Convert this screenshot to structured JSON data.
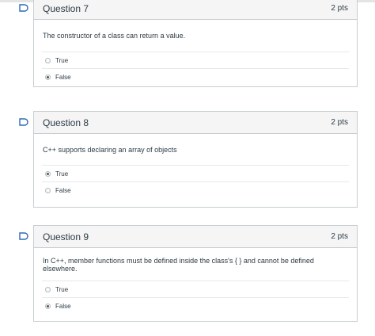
{
  "questions": [
    {
      "title": "Question 7",
      "points": "2 pts",
      "text": "The constructor of a class can return a value.",
      "answers": [
        {
          "label": "True",
          "selected": false
        },
        {
          "label": "False",
          "selected": true
        }
      ]
    },
    {
      "title": "Question 8",
      "points": "2 pts",
      "text": "C++ supports declaring an array of objects",
      "answers": [
        {
          "label": "True",
          "selected": true
        },
        {
          "label": "False",
          "selected": false
        }
      ]
    },
    {
      "title": "Question 9",
      "points": "2 pts",
      "text": "In C++, member functions must be defined inside the class's { } and cannot be defined elsewhere.",
      "answers": [
        {
          "label": "True",
          "selected": false
        },
        {
          "label": "False",
          "selected": true
        }
      ]
    }
  ],
  "colors": {
    "flag": "#2d6bb5",
    "border": "#c7cdd1",
    "header_bg": "#f5f5f5"
  }
}
